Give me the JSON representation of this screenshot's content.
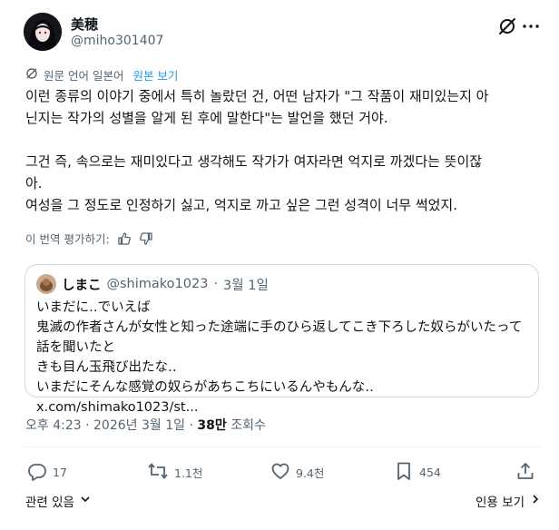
{
  "author": {
    "name": "美穂",
    "handle": "@miho301407"
  },
  "icons": {
    "grok": "grok-icon",
    "more": "more-icon",
    "translate": "translate-icon",
    "thumb_up": "thumb-up-icon",
    "thumb_down": "thumb-down-icon"
  },
  "translation": {
    "note": "원문 언어 일본어",
    "show_original": "원본 보기"
  },
  "tweet_text": "이런 종류의 이야기 중에서 특히 놀랐던 건, 어떤 남자가 \"그 작품이 재미있는지 아\n닌지는 작가의 성별을 알게 된 후에 말한다\"는 발언을 했던 거야.\n\n그건 즉, 속으로는 재미있다고 생각해도 작가가 여자라면 억지로 까겠다는 뜻이잖\n아.\n여성을 그 정도로 인정하기 싫고, 억지로 까고 싶은 그런 성격이 너무 썩었지.",
  "rate": {
    "label": "이 번역 평가하기:"
  },
  "quote": {
    "name": "しまこ",
    "handle": "@shimako1023",
    "sep": "·",
    "date": "3월 1일",
    "text": "いまだに‥でいえば\n鬼滅の作者さんが女性と知った途端に手のひら返してこき下ろした奴らがいたって話を聞いたと\nきも目ん玉飛び出たな‥\nいまだにそんな感覚の奴らがあちこちにいるんやもんな‥",
    "link": "x.com/shimako1023/st..."
  },
  "meta": {
    "time": "오후 4:23",
    "sep1": "·",
    "date": "2026년 3월 1일",
    "sep2": "·",
    "views": "38만",
    "views_label": "조회수"
  },
  "actions": {
    "replies": "17",
    "reposts": "1.1천",
    "likes": "9.4천",
    "bookmarks": "454"
  },
  "footer": {
    "related": "관련 있음",
    "quotes": "인용 보기"
  }
}
